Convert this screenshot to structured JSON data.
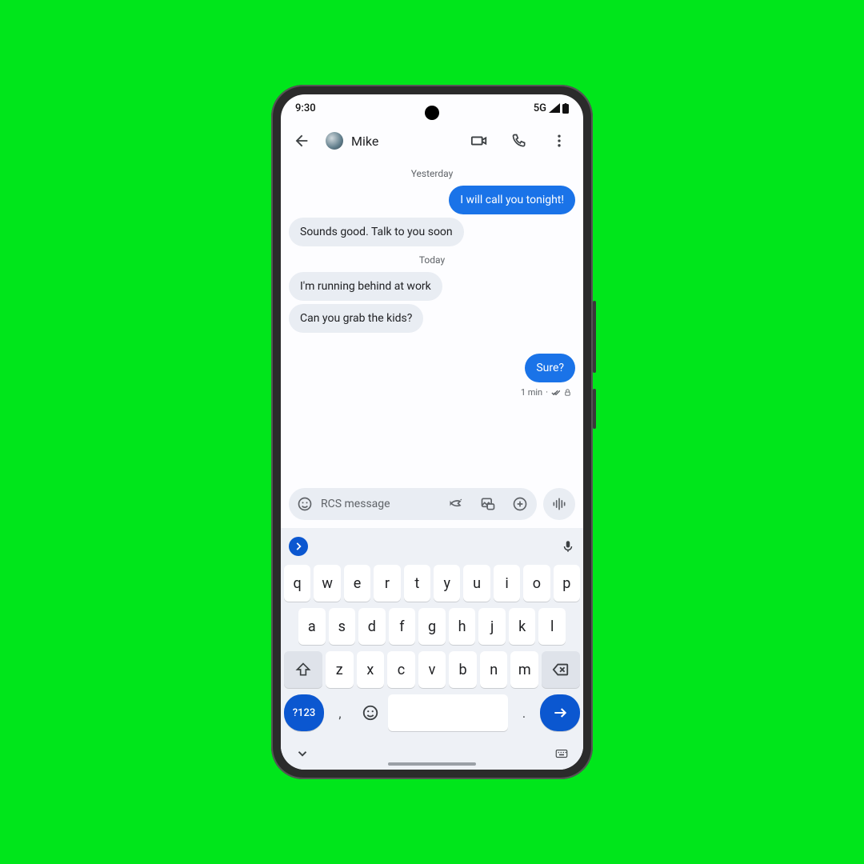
{
  "status": {
    "time": "9:30",
    "network": "5G"
  },
  "appbar": {
    "title": "Mike"
  },
  "conversation": {
    "section1_label": "Yesterday",
    "section2_label": "Today",
    "msg_out_1": "I will call you tonight!",
    "msg_in_1": "Sounds good. Talk to you soon",
    "msg_in_2": "I'm running behind at work",
    "msg_in_3": "Can you grab the kids?",
    "msg_out_2": "Sure?",
    "meta_time": "1 min",
    "meta_sep": "·"
  },
  "composer": {
    "placeholder": "RCS message"
  },
  "keyboard": {
    "row1": [
      "q",
      "w",
      "e",
      "r",
      "t",
      "y",
      "u",
      "i",
      "o",
      "p"
    ],
    "row2": [
      "a",
      "s",
      "d",
      "f",
      "g",
      "h",
      "j",
      "k",
      "l"
    ],
    "row3": [
      "z",
      "x",
      "c",
      "v",
      "b",
      "n",
      "m"
    ],
    "sym": "?123",
    "comma": ",",
    "period": "."
  }
}
